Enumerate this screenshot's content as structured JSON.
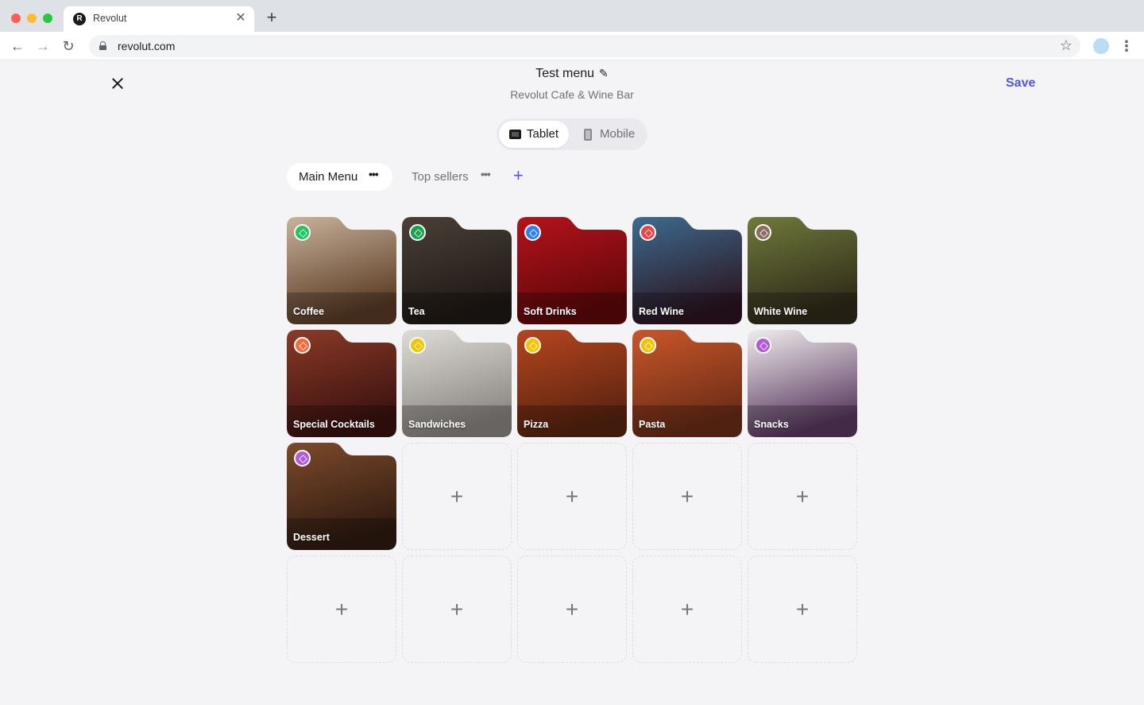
{
  "browser": {
    "tab_title": "Revolut",
    "favicon_letter": "R",
    "url": "revolut.com"
  },
  "header": {
    "title": "Test menu",
    "subtitle": "Revolut Cafe & Wine Bar",
    "save_label": "Save"
  },
  "view_toggle": {
    "options": [
      "Tablet",
      "Mobile"
    ],
    "selected": "Tablet"
  },
  "menu_tabs": [
    {
      "label": "Main Menu",
      "active": true
    },
    {
      "label": "Top sellers",
      "active": false
    }
  ],
  "grid": {
    "items": [
      {
        "label": "Coffee",
        "badge_color": "#22c55e",
        "bg_top": "#c8b29a",
        "bg_bottom": "#5a3b24"
      },
      {
        "label": "Tea",
        "badge_color": "#16a34a",
        "bg_top": "#4a4038",
        "bg_bottom": "#1e1814"
      },
      {
        "label": "Soft Drinks",
        "badge_color": "#2f80ed",
        "bg_top": "#b5131b",
        "bg_bottom": "#5e0709"
      },
      {
        "label": "Red Wine",
        "badge_color": "#ef4444",
        "bg_top": "#3d6b8f",
        "bg_bottom": "#2b1520"
      },
      {
        "label": "White Wine",
        "badge_color": "#8b6e5e",
        "bg_top": "#6f7a3a",
        "bg_bottom": "#2f2a1a"
      },
      {
        "label": "Special Cocktails",
        "badge_color": "#f26b3a",
        "bg_top": "#8a3a26",
        "bg_bottom": "#3a1210"
      },
      {
        "label": "Sandwiches",
        "badge_color": "#f5c400",
        "bg_top": "#dfdcd8",
        "bg_bottom": "#8a8682"
      },
      {
        "label": "Pizza",
        "badge_color": "#f5c400",
        "bg_top": "#b6451f",
        "bg_bottom": "#5a2410"
      },
      {
        "label": "Pasta",
        "badge_color": "#f5c400",
        "bg_top": "#c9562a",
        "bg_bottom": "#6a2c16"
      },
      {
        "label": "Snacks",
        "badge_color": "#b15bd9",
        "bg_top": "#f0eded",
        "bg_bottom": "#5a3a60"
      },
      {
        "label": "Dessert",
        "badge_color": "#b15bd9",
        "bg_top": "#7d4a2b",
        "bg_bottom": "#2e1a10"
      }
    ],
    "empty_slots": 9
  },
  "icons": {
    "close": "close-icon",
    "edit": "pencil-icon",
    "tablet": "tablet-icon",
    "mobile": "mobile-icon",
    "more": "more-dots-icon",
    "add": "plus-icon",
    "category": "layers-icon"
  },
  "colors": {
    "accent": "#4f55f1",
    "background": "#f4f4f6"
  }
}
